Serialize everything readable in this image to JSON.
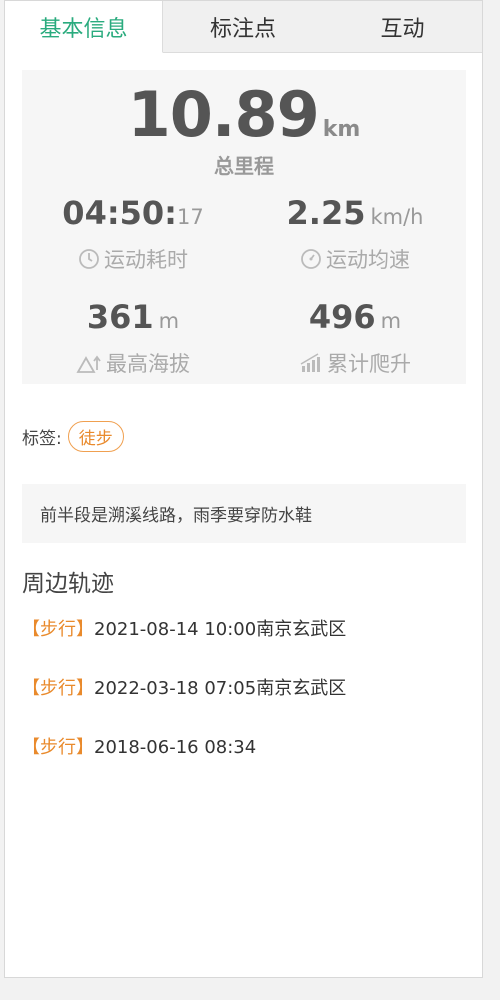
{
  "tabs": [
    {
      "label": "基本信息",
      "active": true
    },
    {
      "label": "标注点",
      "active": false
    },
    {
      "label": "互动",
      "active": false
    }
  ],
  "stats": {
    "total_distance": "10.89",
    "total_unit": "km",
    "total_label": "总里程",
    "duration_main": "04:50:",
    "duration_seconds": "17",
    "duration_label": "运动耗时",
    "avg_speed": "2.25",
    "avg_speed_unit": "km/h",
    "avg_speed_label": "运动均速",
    "max_altitude": "361",
    "max_altitude_unit": "m",
    "max_altitude_label": "最高海拔",
    "total_climb": "496",
    "total_climb_unit": "m",
    "total_climb_label": "累计爬升"
  },
  "tags": {
    "label": "标签:",
    "items": [
      "徒步"
    ]
  },
  "note": "前半段是溯溪线路，雨季要穿防水鞋",
  "nearby": {
    "title": "周边轨迹",
    "tracks": [
      {
        "type": "【步行】",
        "text": "2021-08-14 10:00南京玄武区"
      },
      {
        "type": "【步行】",
        "text": "2022-03-18 07:05南京玄武区"
      },
      {
        "type": "【步行】",
        "text": "2018-06-16 08:34"
      }
    ]
  },
  "colors": {
    "accent_green": "#2aab7e",
    "accent_orange": "#e98a2c"
  }
}
